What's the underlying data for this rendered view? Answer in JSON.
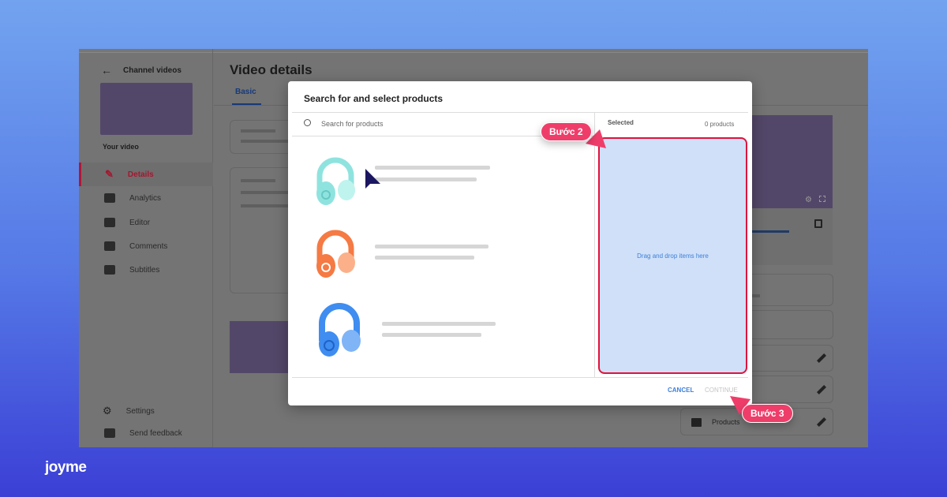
{
  "background": {
    "logo": "joyme"
  },
  "sidebar": {
    "back_title": "Channel videos",
    "your_video": "Your video",
    "items": [
      {
        "label": "Details",
        "icon": "pencil-icon",
        "active": true
      },
      {
        "label": "Analytics",
        "icon": "analytics-icon"
      },
      {
        "label": "Editor",
        "icon": "clapperboard-icon"
      },
      {
        "label": "Comments",
        "icon": "comment-icon"
      },
      {
        "label": "Subtitles",
        "icon": "subtitles-icon"
      }
    ],
    "bottom": [
      {
        "label": "Settings",
        "icon": "gear-icon"
      },
      {
        "label": "Send feedback",
        "icon": "feedback-icon"
      }
    ]
  },
  "main": {
    "title": "Video details",
    "tabs": [
      {
        "label": "Basic",
        "active": true
      }
    ],
    "products_label": "Products"
  },
  "modal": {
    "title": "Search for and select products",
    "search_placeholder": "Search for products",
    "selected_label": "Selected",
    "selected_count": "0 products",
    "drop_text": "Drag and drop items here",
    "cancel": "CANCEL",
    "continue": "CONTINUE",
    "products": [
      {
        "color": "#8fe3df"
      },
      {
        "color": "#f57a43"
      },
      {
        "color": "#3f8df0"
      }
    ]
  },
  "annotations": {
    "step2": "Bước 2",
    "step3": "Bước 3"
  },
  "colors": {
    "accent_red": "#e0123c",
    "drop_bg": "#cfe0f8",
    "link_blue": "#3f7fd9",
    "pill": "#ef3d6a"
  }
}
